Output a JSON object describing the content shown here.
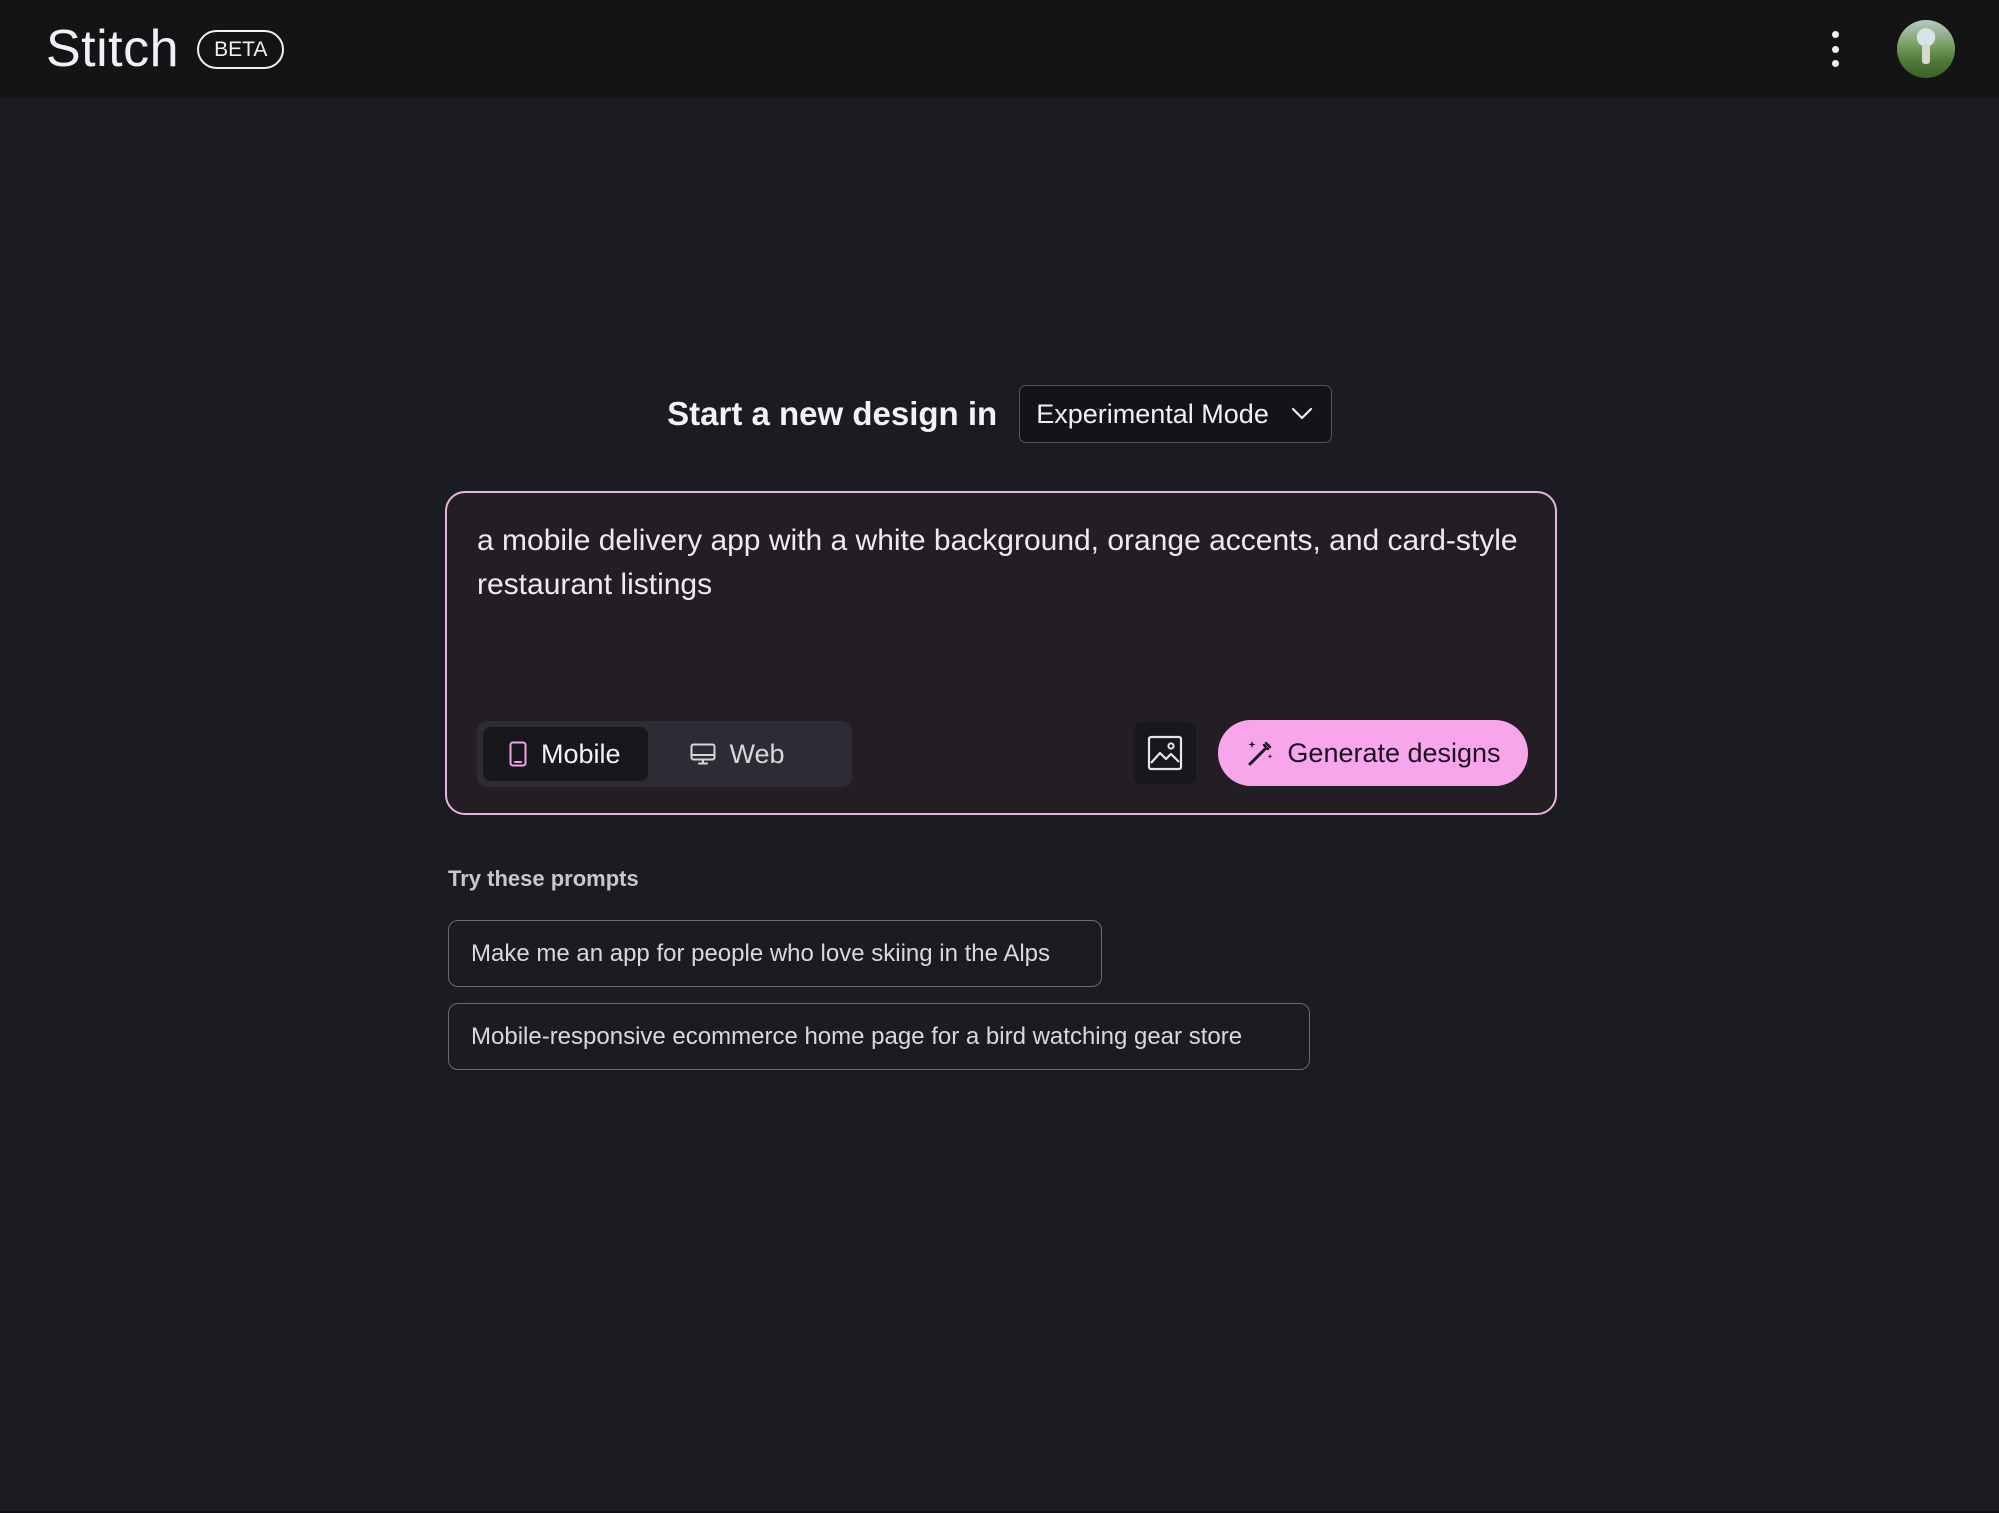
{
  "app": {
    "name": "Stitch",
    "badge": "BETA"
  },
  "header": {
    "menu_icon": "more-vert-icon",
    "avatar_icon": "user-avatar"
  },
  "main": {
    "heading": "Start a new design in",
    "mode_select": {
      "value": "Experimental Mode",
      "icon": "chevron-down-icon"
    },
    "prompt": {
      "value": "a mobile delivery app with a white background, orange accents, and card-style restaurant listings"
    },
    "device_toggle": {
      "mobile_label": "Mobile",
      "mobile_icon": "phone-icon",
      "web_label": "Web",
      "web_icon": "monitor-icon",
      "selected": "Mobile"
    },
    "image_button_icon": "image-icon",
    "generate": {
      "label": "Generate designs",
      "icon": "magic-wand-icon"
    }
  },
  "suggestions": {
    "title": "Try these prompts",
    "items": [
      "Make me an app for people who love skiing in the Alps",
      "Mobile-responsive ecommerce home page for a bird watching gear store"
    ]
  },
  "colors": {
    "background": "#1b1c21",
    "topbar": "#141416",
    "accent_pink": "#f7a6ec",
    "card_border": "#e7b4df"
  }
}
